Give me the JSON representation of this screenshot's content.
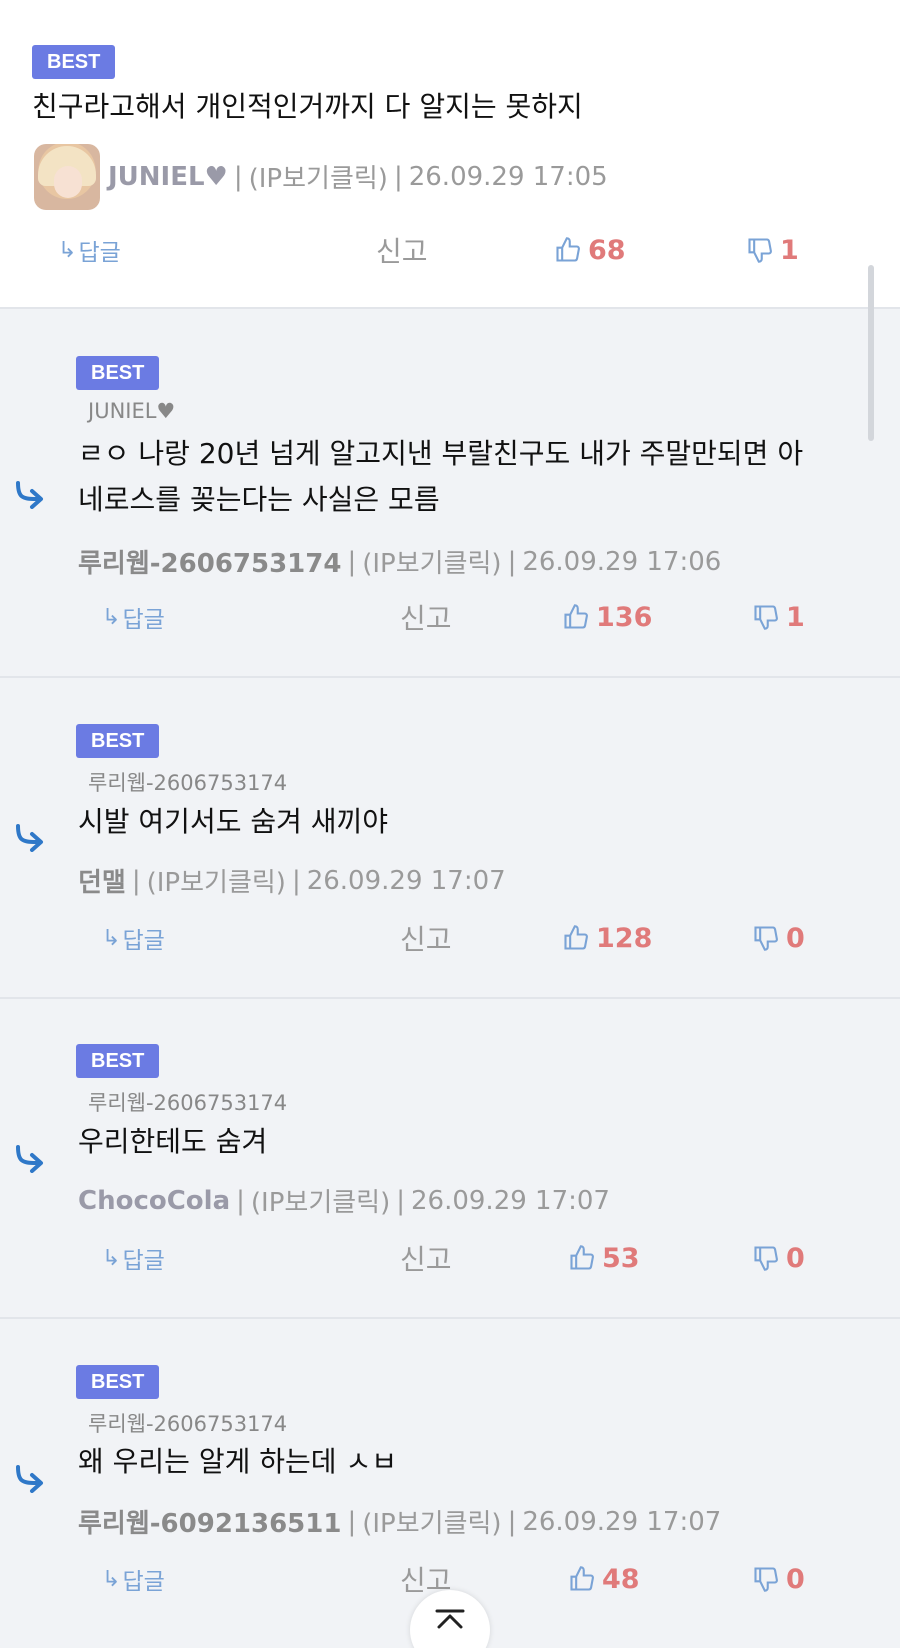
{
  "labels": {
    "best": "BEST",
    "reply": "답글",
    "report": "신고",
    "ip_click": "(IP보기클릭)"
  },
  "comments": [
    {
      "text": "친구라고해서 개인적인거까지 다 알지는 못하지",
      "author": "JUNIEL♥",
      "timestamp": "26.09.29 17:05",
      "likes": "68",
      "dislikes": "1"
    },
    {
      "reply_to": "JUNIEL♥",
      "text_line1": "ㄹㅇ 나랑 20년 넘게 알고지낸 부랄친구도 내가 주말만되면 아",
      "text_line2": "네로스를 꽂는다는 사실은 모름",
      "author": "루리웹-2606753174",
      "timestamp": "26.09.29 17:06",
      "likes": "136",
      "dislikes": "1"
    },
    {
      "reply_to": "루리웹-2606753174",
      "text": "시발 여기서도 숨겨 새끼야",
      "author": "던맬",
      "timestamp": "26.09.29 17:07",
      "likes": "128",
      "dislikes": "0"
    },
    {
      "reply_to": "루리웹-2606753174",
      "text": "우리한테도 숨겨",
      "author": "ChocoCola",
      "timestamp": "26.09.29 17:07",
      "likes": "53",
      "dislikes": "0"
    },
    {
      "reply_to": "루리웹-2606753174",
      "text": "왜 우리는 알게 하는데 ㅅㅂ",
      "author": "루리웹-6092136511",
      "timestamp": "26.09.29 17:07",
      "likes": "48",
      "dislikes": "0"
    }
  ],
  "colors": {
    "best_badge": "#6b7be3",
    "reply_bg": "#f1f3f6",
    "vote_count": "#e07a7a",
    "icon_blue": "#2f78c8",
    "reply_link": "#7aa3d6"
  },
  "icons": {
    "like": "thumbs-up-icon",
    "dislike": "thumbs-down-icon",
    "reply_arrow": "reply-arrow-icon",
    "scroll_top": "chevron-up-icon"
  }
}
